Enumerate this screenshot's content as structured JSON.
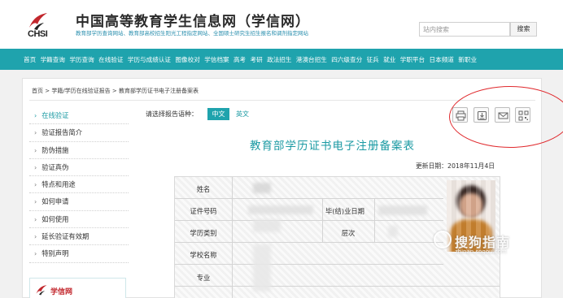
{
  "header": {
    "logo_text": "CHSI",
    "site_title": "中国高等教育学生信息网（学信网）",
    "site_subtitle": "教育部学历查询网站、教育部高校招生阳光工程指定网站、全国硕士研究生招生报名和调剂指定网站",
    "search_placeholder": "站内搜索",
    "search_button": "搜索"
  },
  "nav": {
    "items": [
      "首页",
      "学籍查询",
      "学历查询",
      "在线验证",
      "学历与成绩认证",
      "图像校对",
      "学信档案",
      "高考",
      "考研",
      "政法招生",
      "港澳台招生",
      "四六级查分",
      "征兵",
      "就业",
      "学职平台",
      "日本频道",
      "新职业"
    ]
  },
  "breadcrumb": "首页 > 学籍/学历在线验证报告 > 教育部学历证书电子注册备案表",
  "sidebar": {
    "items": [
      "在线验证",
      "验证报告简介",
      "防伪措施",
      "验证真伪",
      "特点和用途",
      "如何申请",
      "如何使用",
      "延长验证有效期",
      "特别声明"
    ],
    "active_index": 0,
    "logo_text": "学信网"
  },
  "main": {
    "language_label": "请选择报告语种：",
    "lang_zh": "中文",
    "lang_en": "英文",
    "tools": [
      "print-icon",
      "download-icon",
      "mail-icon",
      "qrcode-icon"
    ],
    "report_title": "教育部学历证书电子注册备案表",
    "update_date": "更新日期：2018年11月4日"
  },
  "certificate": {
    "labels": {
      "name": "姓名",
      "id_number": "证件号码",
      "graduation": "毕(结)业日期",
      "education_type": "学历类别",
      "level": "层次",
      "school": "学校名称",
      "major": "专业"
    }
  },
  "watermark": {
    "text": "搜狗指南",
    "sub": "zhinan.sogou.com"
  },
  "colors": {
    "brand_teal": "#1fa3ad",
    "highlight_red": "#e0292d",
    "logo_red": "#c2272d"
  }
}
